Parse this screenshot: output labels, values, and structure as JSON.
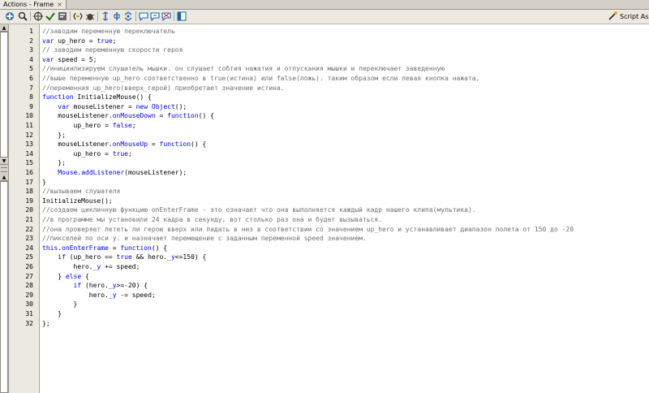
{
  "tab": {
    "title": "Actions - Frame",
    "close_glyph": "×"
  },
  "toolbar": {
    "icons": [
      "add-statement-icon",
      "find-icon",
      "insert-target-path-icon",
      "check-syntax-icon",
      "auto-format-icon",
      "show-code-hint-icon",
      "debug-options-icon",
      "collapse-between-braces-icon",
      "collapse-selection-icon",
      "expand-all-icon",
      "apply-block-comment-icon",
      "apply-line-comment-icon",
      "remove-comment-icon",
      "show-hide-toolbox-icon"
    ],
    "script_assist_label": "Script Assi"
  },
  "left_panel": {
    "up": "▲",
    "down": "▼"
  },
  "editor": {
    "line_numbers": [
      "1",
      "2",
      "3",
      "4",
      "5",
      "6",
      "7",
      "8",
      "9",
      "10",
      "11",
      "12",
      "13",
      "14",
      "15",
      "16",
      "17",
      "18",
      "19",
      "20",
      "21",
      "22",
      "23",
      "24",
      "25",
      "26",
      "27",
      "28",
      "29",
      "30",
      "31",
      "32"
    ],
    "lines": [
      [
        {
          "t": "//заводим переменную переключатель",
          "c": "c"
        }
      ],
      [
        {
          "t": "var",
          "c": "k"
        },
        {
          "t": " up_hero = ",
          "c": "txt"
        },
        {
          "t": "true",
          "c": "k"
        },
        {
          "t": ";",
          "c": "txt"
        }
      ],
      [
        {
          "t": "// заводим переменную скорости героя",
          "c": "c"
        }
      ],
      [
        {
          "t": "var",
          "c": "k"
        },
        {
          "t": " speed = 5;",
          "c": "txt"
        }
      ],
      [
        {
          "t": "//инициилизируем слушатель мышки. он слушает собтия нажатия и отпускания мышки и переключает заведенную",
          "c": "c"
        }
      ],
      [
        {
          "t": "//выше переменную up_hero соответственно в true(истина) или false(ложь). таким образом если левая кнопка нажата,",
          "c": "c"
        }
      ],
      [
        {
          "t": "//переменная up_hero(вверх_герой) приобретает значение истина.",
          "c": "c"
        }
      ],
      [
        {
          "t": "function",
          "c": "k"
        },
        {
          "t": " InitializeMouse() {",
          "c": "txt"
        }
      ],
      [
        {
          "t": "    ",
          "c": "txt"
        },
        {
          "t": "var",
          "c": "k"
        },
        {
          "t": " mouseListener = ",
          "c": "txt"
        },
        {
          "t": "new",
          "c": "k"
        },
        {
          "t": " ",
          "c": "txt"
        },
        {
          "t": "Object",
          "c": "k"
        },
        {
          "t": "();",
          "c": "txt"
        }
      ],
      [
        {
          "t": "    mouseListener.",
          "c": "txt"
        },
        {
          "t": "onMouseDown",
          "c": "k"
        },
        {
          "t": " = ",
          "c": "txt"
        },
        {
          "t": "function",
          "c": "k"
        },
        {
          "t": "() {",
          "c": "txt"
        }
      ],
      [
        {
          "t": "        up_hero = ",
          "c": "txt"
        },
        {
          "t": "false",
          "c": "k"
        },
        {
          "t": ";",
          "c": "txt"
        }
      ],
      [
        {
          "t": "    };",
          "c": "txt"
        }
      ],
      [
        {
          "t": "    mouseListener.",
          "c": "txt"
        },
        {
          "t": "onMouseUp",
          "c": "k"
        },
        {
          "t": " = ",
          "c": "txt"
        },
        {
          "t": "function",
          "c": "k"
        },
        {
          "t": "() {",
          "c": "txt"
        }
      ],
      [
        {
          "t": "        up_hero = ",
          "c": "txt"
        },
        {
          "t": "true",
          "c": "k"
        },
        {
          "t": ";",
          "c": "txt"
        }
      ],
      [
        {
          "t": "    };",
          "c": "txt"
        }
      ],
      [
        {
          "t": "    ",
          "c": "txt"
        },
        {
          "t": "Mouse",
          "c": "k"
        },
        {
          "t": ".",
          "c": "txt"
        },
        {
          "t": "addListener",
          "c": "k"
        },
        {
          "t": "(mouseListener);",
          "c": "txt"
        }
      ],
      [
        {
          "t": "}",
          "c": "txt"
        }
      ],
      [
        {
          "t": "//вызываем слушателя",
          "c": "c"
        }
      ],
      [
        {
          "t": "InitializeMouse();",
          "c": "txt"
        }
      ],
      [
        {
          "t": "//создаем цикличную функцию onEnterFrame - это означает что она выполняется каждый кадр нашего клипа(мультика).",
          "c": "c"
        }
      ],
      [
        {
          "t": "//в программе мы установили 24 кадра в секунду, вот столько раз она и будет вызываться.",
          "c": "c"
        }
      ],
      [
        {
          "t": "//она проверяет лететь ли герою вверх или падать в низ в соответствии со значением up_hero и устанавливает диапазон полета от 150 до -20",
          "c": "c"
        }
      ],
      [
        {
          "t": "//пикселей по оси y. и назначает перемещение с заданным переменной speed значением.",
          "c": "c"
        }
      ],
      [
        {
          "t": "this",
          "c": "k"
        },
        {
          "t": ".",
          "c": "txt"
        },
        {
          "t": "onEnterFrame",
          "c": "k"
        },
        {
          "t": " = ",
          "c": "txt"
        },
        {
          "t": "function",
          "c": "k"
        },
        {
          "t": "() {",
          "c": "txt"
        }
      ],
      [
        {
          "t": "    ",
          "c": "txt"
        },
        {
          "t": "if",
          "c": "k"
        },
        {
          "t": " (up_hero == ",
          "c": "txt"
        },
        {
          "t": "true",
          "c": "k"
        },
        {
          "t": " && hero.",
          "c": "txt"
        },
        {
          "t": "_y",
          "c": "k"
        },
        {
          "t": "<=150) {",
          "c": "txt"
        }
      ],
      [
        {
          "t": "        hero.",
          "c": "txt"
        },
        {
          "t": "_y",
          "c": "k"
        },
        {
          "t": " += speed;",
          "c": "txt"
        }
      ],
      [
        {
          "t": "    } ",
          "c": "txt"
        },
        {
          "t": "else",
          "c": "k"
        },
        {
          "t": " {",
          "c": "txt"
        }
      ],
      [
        {
          "t": "        ",
          "c": "txt"
        },
        {
          "t": "if",
          "c": "k"
        },
        {
          "t": " (hero.",
          "c": "txt"
        },
        {
          "t": "_y",
          "c": "k"
        },
        {
          "t": ">=-20) {",
          "c": "txt"
        }
      ],
      [
        {
          "t": "            hero.",
          "c": "txt"
        },
        {
          "t": "_y",
          "c": "k"
        },
        {
          "t": " -= speed;",
          "c": "txt"
        }
      ],
      [
        {
          "t": "        }",
          "c": "txt"
        }
      ],
      [
        {
          "t": "    }",
          "c": "txt"
        }
      ],
      [
        {
          "t": "};",
          "c": "txt"
        }
      ]
    ]
  },
  "colors": {
    "keyword": "#0000ff",
    "comment": "#6f6f6f",
    "text": "#000000",
    "chrome": "#ece9e0"
  }
}
